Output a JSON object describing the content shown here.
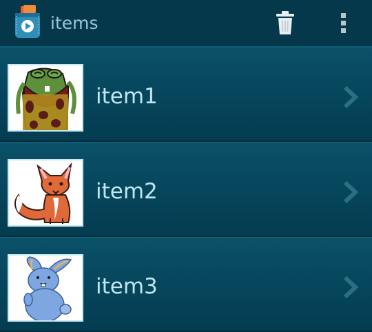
{
  "actionbar": {
    "title": "items",
    "logo_icon": "pocket-app-logo-icon",
    "trash_icon": "trash-icon",
    "overflow_icon": "more-vert-icon"
  },
  "list": {
    "items": [
      {
        "label": "item1",
        "thumbnail_icon": "green-monster-icon"
      },
      {
        "label": "item2",
        "thumbnail_icon": "fox-icon"
      },
      {
        "label": "item3",
        "thumbnail_icon": "bunny-icon"
      }
    ],
    "chevron_icon": "chevron-right-icon"
  },
  "colors": {
    "background": "#033a4c",
    "actionbar": "#04384a",
    "title_text": "#9bc6d3",
    "row_text": "#bfe7f1",
    "thumb_border": "#c7eaf2",
    "chevron": "#2a6f82"
  }
}
